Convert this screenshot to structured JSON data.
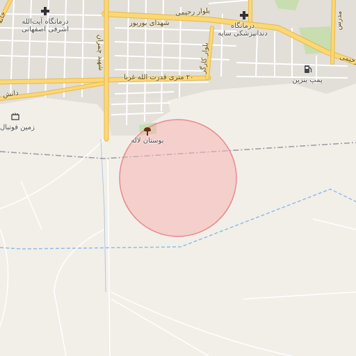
{
  "labels": {
    "clinic_1": "درمانگاه آیت‌الله",
    "clinic_1b": "اشرفی اصفهانی",
    "clinic_2": "درمانگاه",
    "clinic_2b": "دندانپزشکی سایه",
    "gas_station": "پمپ بنزین",
    "football_field": "زمین فوتبال",
    "park": "بوستان لاله"
  },
  "roads": {
    "r_rahimi": "بلوار رحیمی",
    "r_shohada": "شهدای بوربور",
    "r_20m": "۲۰ متری قدرت الله غرنا",
    "r_danesh": "دانش",
    "r_vertical": "بلوار کارگر",
    "r_chamran": "شهید چمران",
    "r_left_top": "خانه",
    "r_right_top": "مدرس",
    "r_right_edge": "رحیمی"
  },
  "colors": {
    "background": "#f2efe9",
    "major_road": "#fbd873",
    "major_road_casing": "#e8b84a",
    "minor_road": "#ffffff",
    "urban": "#e2ded8",
    "circle_fill": "#f6b5b5",
    "circle_stroke": "#e88a8a",
    "water_dashed": "#8fbbe8",
    "green": "#c8ddb0"
  },
  "icons": {
    "clinic_icon": "plus-icon",
    "gas_icon": "fuel-icon",
    "football_icon": "stadium-icon",
    "park_icon": "tree-icon"
  }
}
